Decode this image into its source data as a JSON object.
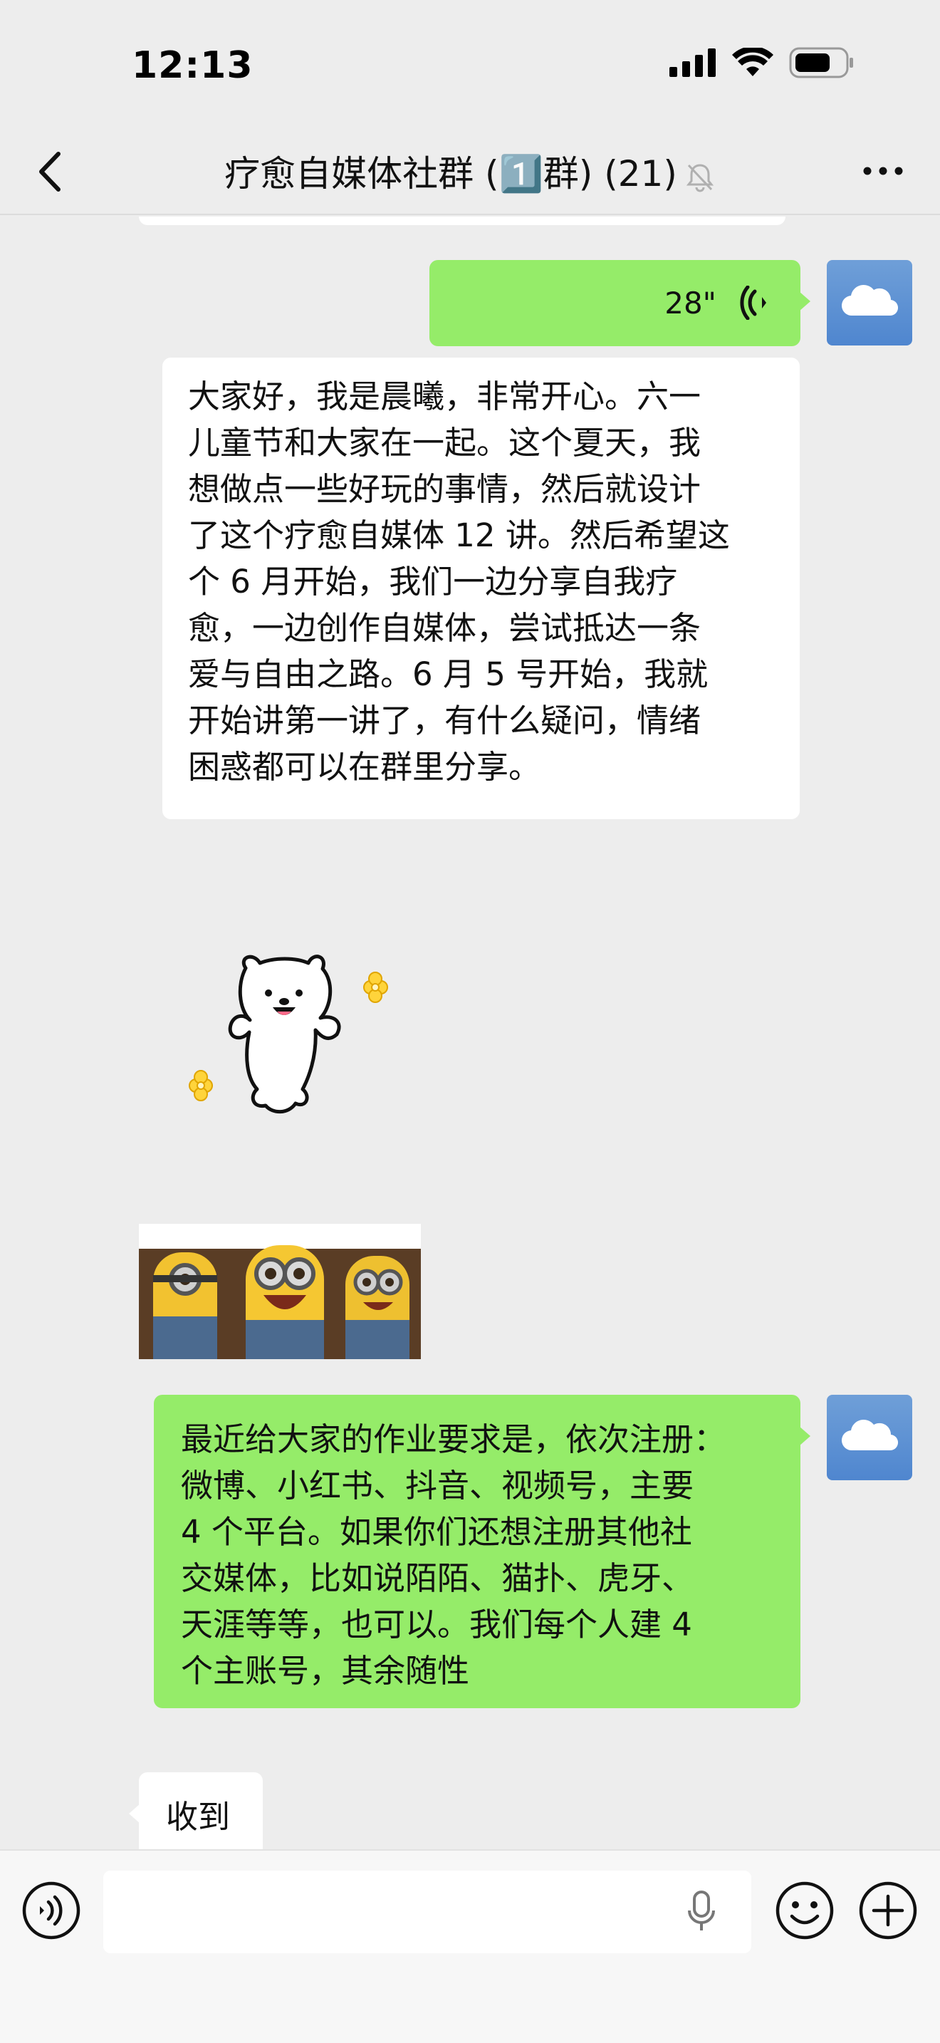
{
  "status_bar": {
    "time": "12:13"
  },
  "nav": {
    "title": "疗愈自媒体社群 (1️⃣群) (21)",
    "back_icon": "chevron-left-icon",
    "mute_icon": "bell-slash-icon",
    "more_icon": "ellipsis-icon"
  },
  "messages": [
    {
      "sender": "self",
      "type": "voice",
      "duration": "28\""
    },
    {
      "sender": "other",
      "type": "text",
      "text": "大家好，我是晨曦，非常开心。六一\n儿童节和大家在一起。这个夏天，我\n想做点一些好玩的事情，然后就设计\n了这个疗愈自媒体 12 讲。然后希望这\n个 6 月开始，我们一边分享自我疗\n愈，一边创作自媒体，尝试抵达一条\n爱与自由之路。6 月 5 号开始，我就\n开始讲第一讲了，有什么疑问，情绪\n困惑都可以在群里分享。"
    },
    {
      "sender": "other",
      "type": "sticker",
      "name": "dancing-bear-sticker"
    },
    {
      "sender": "other",
      "type": "sticker",
      "name": "minions-sticker"
    },
    {
      "sender": "self",
      "type": "text",
      "text": "最近给大家的作业要求是，依次注册：\n微博、小红书、抖音、视频号，主要\n4 个平台。如果你们还想注册其他社\n交媒体，比如说陌陌、猫扑、虎牙、\n天涯等等，也可以。我们每个人建 4\n个主账号，其余随性"
    },
    {
      "sender": "other",
      "type": "text",
      "text": "收到"
    }
  ],
  "input_bar": {
    "placeholder": "",
    "icons": [
      "voice-icon",
      "mic-icon",
      "emoji-icon",
      "plus-icon"
    ]
  },
  "colors": {
    "self_bubble": "#95ec69",
    "other_bubble": "#ffffff",
    "background": "#ededed",
    "avatar": "#5b8fd2"
  }
}
